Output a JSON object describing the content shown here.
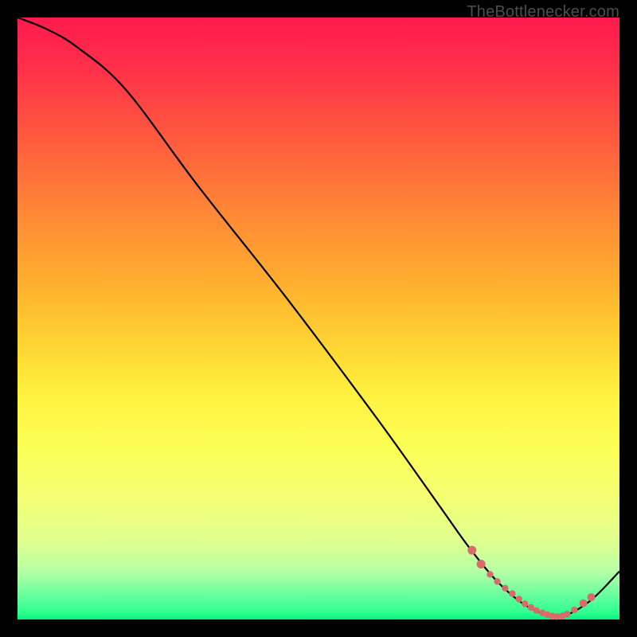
{
  "attribution": "TheBottlenecker.com",
  "chart_data": {
    "type": "line",
    "title": "",
    "xlabel": "",
    "ylabel": "",
    "xlim": [
      0,
      100
    ],
    "ylim": [
      0,
      100
    ],
    "series": [
      {
        "name": "curve",
        "x": [
          0,
          5,
          10,
          18,
          30,
          45,
          60,
          70,
          75,
          80,
          85,
          90,
          95,
          100
        ],
        "y": [
          100,
          98,
          95,
          88,
          72,
          53,
          33,
          19,
          12,
          6,
          2,
          0.5,
          3,
          8
        ]
      }
    ],
    "markers": {
      "name": "dotted-segment",
      "color": "#d96b6b",
      "x": [
        75.5,
        77,
        78.5,
        79.7,
        81,
        82.2,
        83.3,
        84.3,
        85.3,
        86.2,
        87.2,
        88,
        88.8,
        89.6,
        90.5,
        91.3,
        92.5,
        94,
        95.3
      ],
      "y": [
        11.5,
        9.2,
        7.5,
        6.3,
        5.2,
        4.3,
        3.4,
        2.6,
        2,
        1.5,
        1.1,
        0.8,
        0.6,
        0.5,
        0.6,
        0.9,
        1.6,
        2.7,
        3.7
      ]
    }
  }
}
